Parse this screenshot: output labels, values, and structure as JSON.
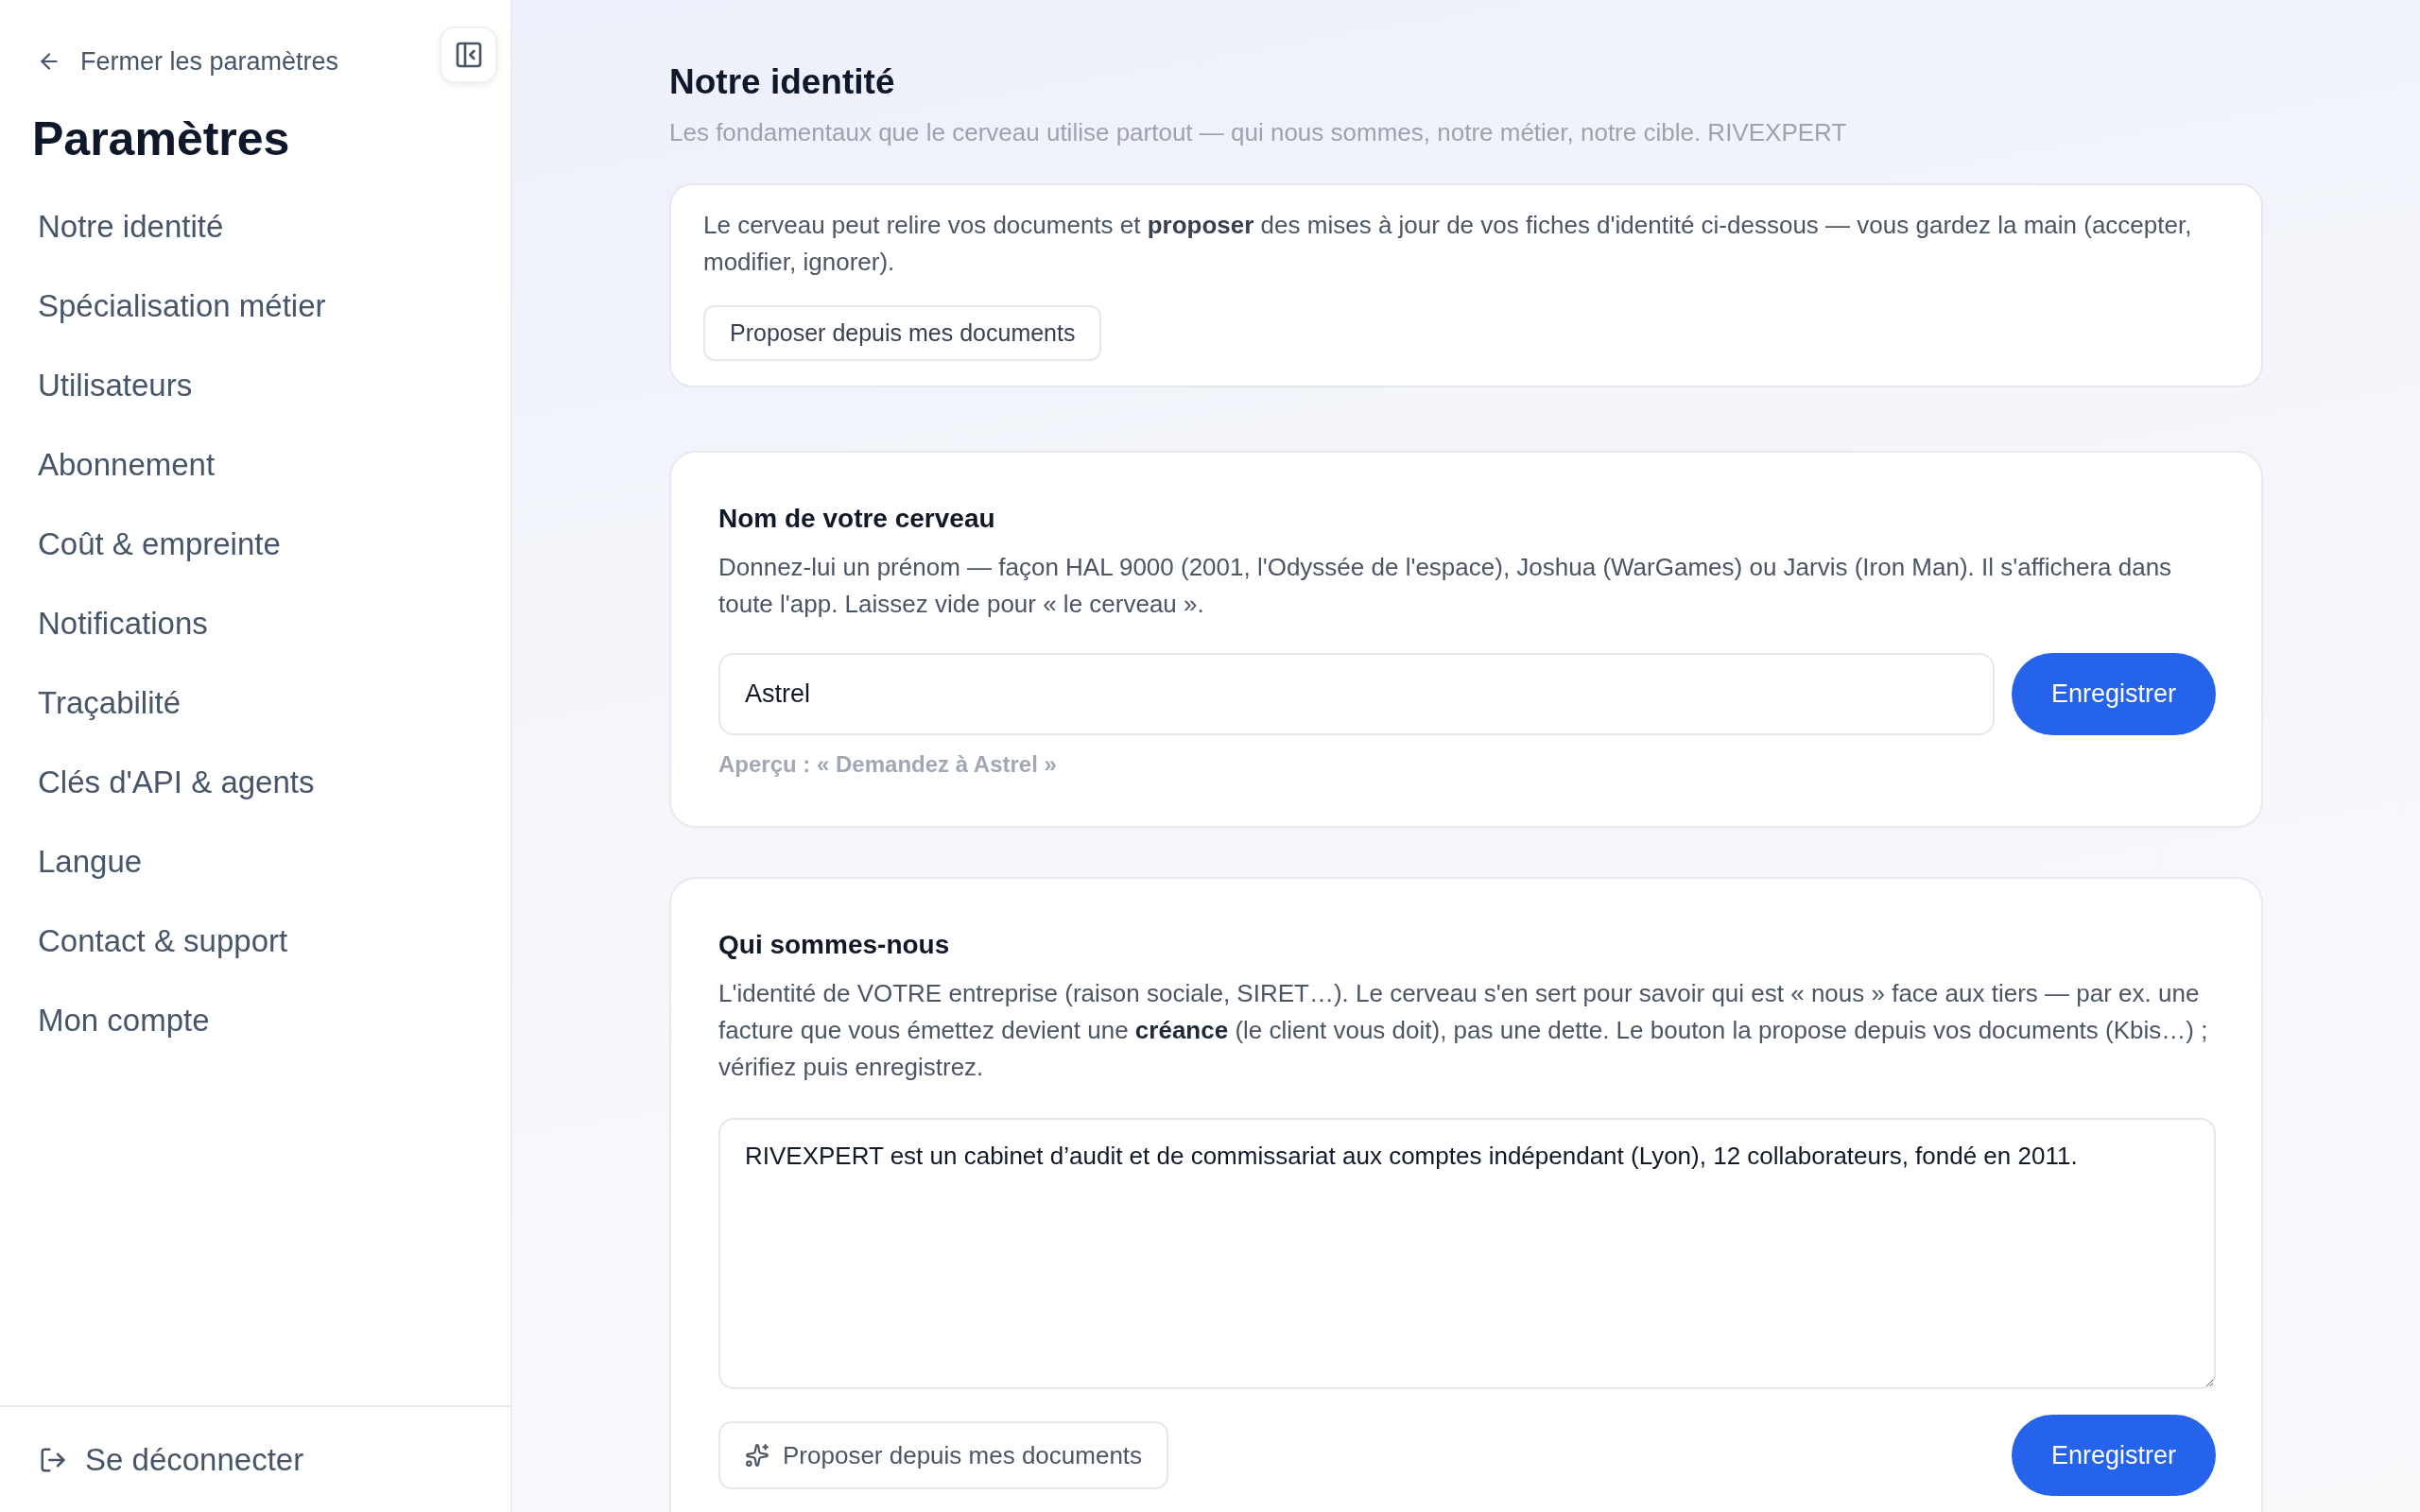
{
  "sidebar": {
    "close_label": "Fermer les paramètres",
    "title": "Paramètres",
    "items": [
      {
        "label": "Notre identité",
        "selected": false
      },
      {
        "label": "Spécialisation métier",
        "selected": false
      },
      {
        "label": "Utilisateurs",
        "selected": false
      },
      {
        "label": "Abonnement",
        "selected": false
      },
      {
        "label": "Coût & empreinte",
        "selected": false
      },
      {
        "label": "Notifications",
        "selected": false
      },
      {
        "label": "Traçabilité",
        "selected": false
      },
      {
        "label": "Clés d'API & agents",
        "selected": false
      },
      {
        "label": "Langue",
        "selected": false
      },
      {
        "label": "Contact & support",
        "selected": false
      },
      {
        "label": "Mon compte",
        "selected": false
      }
    ],
    "logout_label": "Se déconnecter"
  },
  "header": {
    "title": "Notre identité",
    "subtitle": "Les fondamentaux que le cerveau utilise partout — qui nous sommes, notre métier, notre cible. RIVEXPERT"
  },
  "info_card": {
    "text": "Le cerveau peut relire vos documents et **proposer** des mises à jour de vos fiches d'identité ci-dessous — vous gardez la main (accepter, modifier, ignorer).",
    "button": "Proposer depuis mes documents"
  },
  "name_card": {
    "title": "Nom de votre cerveau",
    "description": "Donnez-lui un prénom — façon HAL 9000 (2001, l'Odyssée de l'espace), Joshua (WarGames) ou Jarvis (Iron Man). Il s'affichera dans toute l'app. Laissez vide pour « le cerveau ».",
    "input": {
      "value": "Astrel"
    },
    "save_button": "Enregistrer",
    "preview": "Aperçu : « Demandez à Astrel »"
  },
  "identity_card": {
    "title": "Qui sommes-nous",
    "description": "L'identité de VOTRE entreprise (raison sociale, SIRET…). Le cerveau s'en sert pour savoir qui est « nous » face aux tiers — par ex. une facture que vous émettez devient une **créance** (le client vous doit), pas une dette. Le bouton la propose depuis vos documents (Kbis…) ; vérifiez puis enregistrez.",
    "textarea": {
      "value": "RIVEXPERT est un cabinet d’audit et de commissariat aux comptes indépendant (Lyon), 12 collaborateurs, fondé en 2011."
    },
    "propose_button": "Proposer depuis mes documents",
    "save_button": "Enregistrer"
  }
}
